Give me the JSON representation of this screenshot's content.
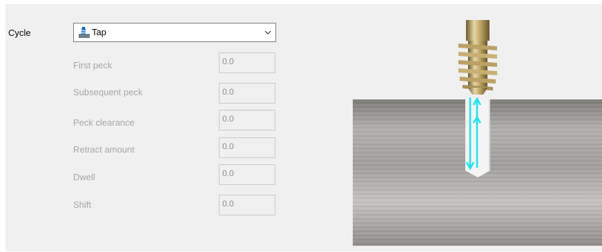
{
  "cycle": {
    "label": "Cycle",
    "selected": "Tap",
    "selected_icon": "tap-cycle-icon"
  },
  "params": [
    {
      "label": "First peck",
      "value": "0.0"
    },
    {
      "label": "Subsequent peck",
      "value": "0.0"
    },
    {
      "label": "Peck clearance",
      "value": "0.0"
    },
    {
      "label": "Retract amount",
      "value": "0.0"
    },
    {
      "label": "Dwell",
      "value": "0.0"
    },
    {
      "label": "Shift",
      "value": "0.0"
    }
  ],
  "colors": {
    "panel_bg": "#f0f0f0",
    "disabled_text": "#a6a6a6",
    "arrow": "#14e6f5",
    "tap_gold": "#c9b27a"
  }
}
